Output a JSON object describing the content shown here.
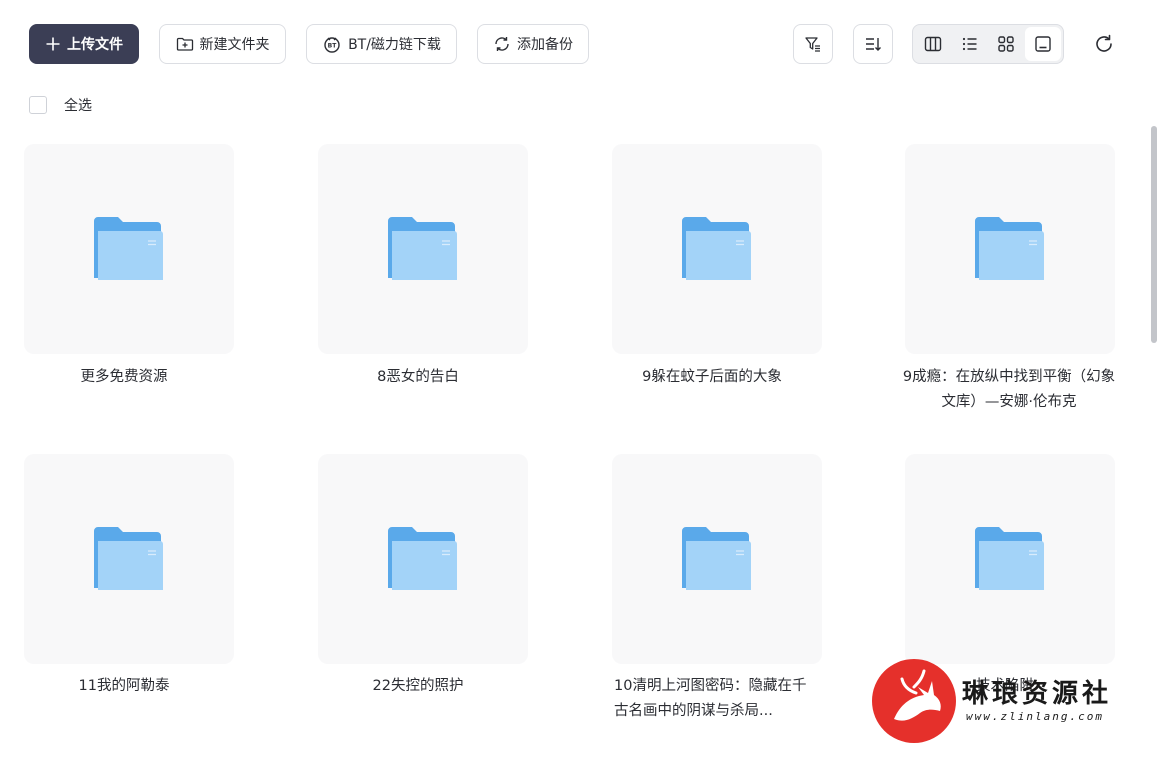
{
  "toolbar": {
    "upload_label": "上传文件",
    "new_folder_label": "新建文件夹",
    "bt_label": "BT/磁力链下载",
    "backup_label": "添加备份"
  },
  "select_all_label": "全选",
  "files": [
    {
      "name": "更多免费资源"
    },
    {
      "name": "8恶女的告白"
    },
    {
      "name": "9躲在蚊子后面的大象"
    },
    {
      "name": "9成瘾：在放纵中找到平衡（幻象文库）—安娜·伦布克"
    },
    {
      "name": "11我的阿勒泰"
    },
    {
      "name": "22失控的照护"
    },
    {
      "name": "10清明上河图密码：隐藏在千古名画中的阴谋与杀局..."
    },
    {
      "name": "技术陷阱"
    }
  ],
  "watermark": {
    "title": "琳琅资源社",
    "url": "www.zlinlang.com"
  },
  "colors": {
    "primary_button": "#3b3e55",
    "folder_back": "#5aa9ea",
    "folder_front": "#9cd0f8",
    "card_bg": "#f8f8f9",
    "watermark_red": "#e5302b"
  }
}
